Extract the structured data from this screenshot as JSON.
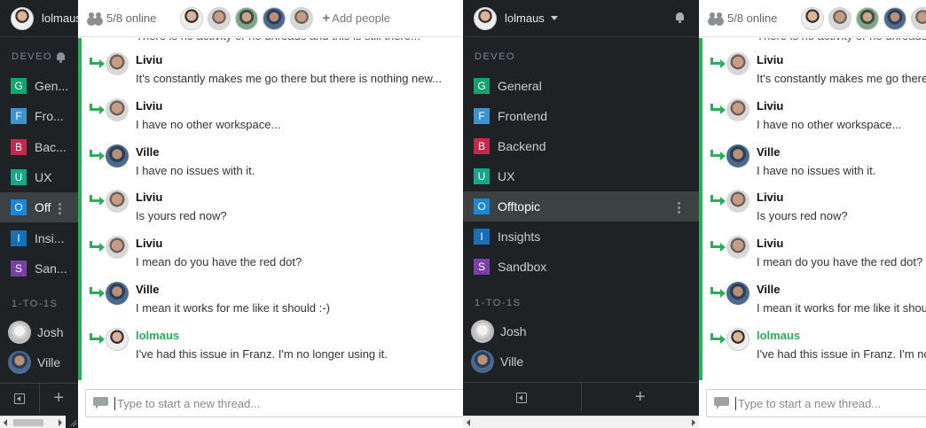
{
  "user": {
    "name": "lolmaus"
  },
  "workspace": {
    "name": "DEVEO"
  },
  "channels": [
    {
      "letter": "G",
      "name": "General",
      "short": "Gen...",
      "color": "#13a36c"
    },
    {
      "letter": "F",
      "name": "Frontend",
      "short": "Fro...",
      "color": "#3b94d0"
    },
    {
      "letter": "B",
      "name": "Backend",
      "short": "Bac...",
      "color": "#c3284f"
    },
    {
      "letter": "U",
      "name": "UX",
      "short": "UX",
      "color": "#17a689"
    },
    {
      "letter": "O",
      "name": "Offtopic",
      "short": "Off",
      "color": "#1a88d8",
      "active": true
    },
    {
      "letter": "I",
      "name": "Insights",
      "short": "Insi...",
      "color": "#1670b8"
    },
    {
      "letter": "S",
      "name": "Sandbox",
      "short": "San...",
      "color": "#7b3fa8"
    }
  ],
  "dm_section": {
    "title": "1-TO-1S"
  },
  "dms": [
    {
      "name": "Josh",
      "avatar": "josh"
    },
    {
      "name": "Ville",
      "avatar": "ville"
    }
  ],
  "header": {
    "online": "5/8 online",
    "add_people": "Add people",
    "avatars": [
      "lolmaus",
      "liviu",
      "green",
      "ville",
      "liviu"
    ]
  },
  "thread": {
    "clipped_text": "There is no activity or no unreads and this is still there...",
    "messages": [
      {
        "author": "Liviu",
        "text": "It's constantly makes me go there but there is nothing new...",
        "avatar": "liviu"
      },
      {
        "author": "Liviu",
        "text": "I have no other workspace...",
        "avatar": "liviu"
      },
      {
        "author": "Ville",
        "text": "I have no issues with it.",
        "avatar": "ville"
      },
      {
        "author": "Liviu",
        "text": "Is yours red now?",
        "avatar": "liviu"
      },
      {
        "author": "Liviu",
        "text": "I mean do you have the red dot?",
        "avatar": "liviu"
      },
      {
        "author": "Ville",
        "text": "I mean it works for me like it should :-)",
        "avatar": "ville"
      },
      {
        "author": "lolmaus",
        "text": "I've had this issue in Franz. I'm no longer using it.",
        "avatar": "lolmaus",
        "self": true
      }
    ]
  },
  "composer": {
    "placeholder": "Type to start a new thread..."
  },
  "footer": {
    "add_symbol": "+"
  }
}
